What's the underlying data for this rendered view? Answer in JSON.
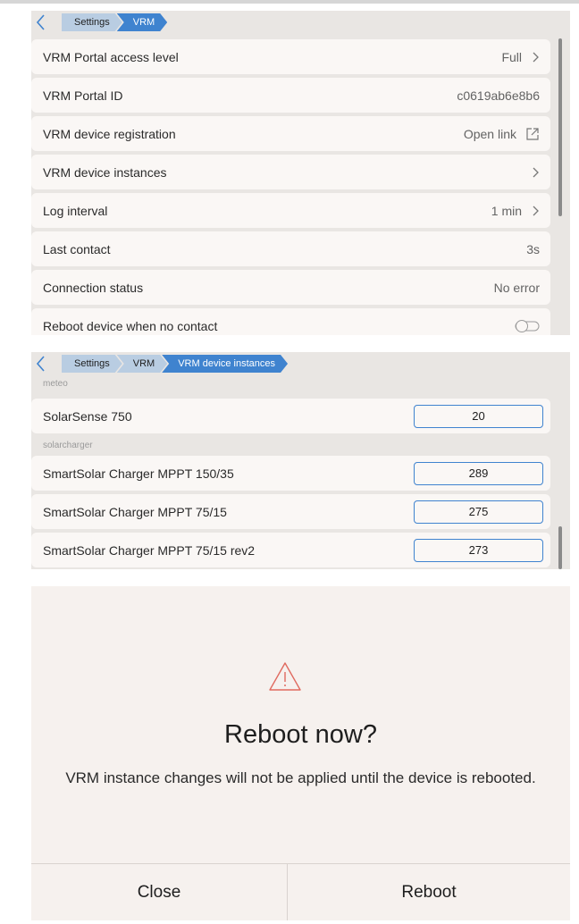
{
  "screen1": {
    "breadcrumbs": [
      "Settings",
      "VRM"
    ],
    "rows": [
      {
        "label": "VRM Portal access level",
        "value": "Full"
      },
      {
        "label": "VRM Portal ID",
        "value": "c0619ab6e8b6"
      },
      {
        "label": "VRM device registration",
        "value": "Open link"
      },
      {
        "label": "VRM device instances",
        "value": ""
      },
      {
        "label": "Log interval",
        "value": "1 min"
      },
      {
        "label": "Last contact",
        "value": "3s"
      },
      {
        "label": "Connection status",
        "value": "No error"
      },
      {
        "label": "Reboot device when no contact",
        "value": ""
      }
    ],
    "reboot_toggle_on": false
  },
  "screen2": {
    "breadcrumbs": [
      "Settings",
      "VRM",
      "VRM device instances"
    ],
    "sections": [
      {
        "name": "meteo",
        "items": [
          {
            "label": "SolarSense 750",
            "instance": "20"
          }
        ]
      },
      {
        "name": "solarcharger",
        "items": [
          {
            "label": "SmartSolar Charger MPPT 150/35",
            "instance": "289"
          },
          {
            "label": "SmartSolar Charger MPPT 75/15",
            "instance": "275"
          },
          {
            "label": "SmartSolar Charger MPPT 75/15 rev2",
            "instance": "273"
          }
        ]
      }
    ]
  },
  "dialog": {
    "title": "Reboot now?",
    "message": "VRM instance changes will not be applied until the device is rebooted.",
    "close_label": "Close",
    "reboot_label": "Reboot"
  },
  "colors": {
    "accent": "#3f83cf",
    "breadcrumb_inactive": "#b9cde2",
    "warning": "#e06a5f",
    "panel_bg": "#e9e6e3",
    "row_bg": "#faf7f5"
  },
  "icons": [
    "back-chevron-icon",
    "chevron-right-icon",
    "external-link-icon",
    "toggle-switch-icon",
    "warning-triangle-icon"
  ]
}
